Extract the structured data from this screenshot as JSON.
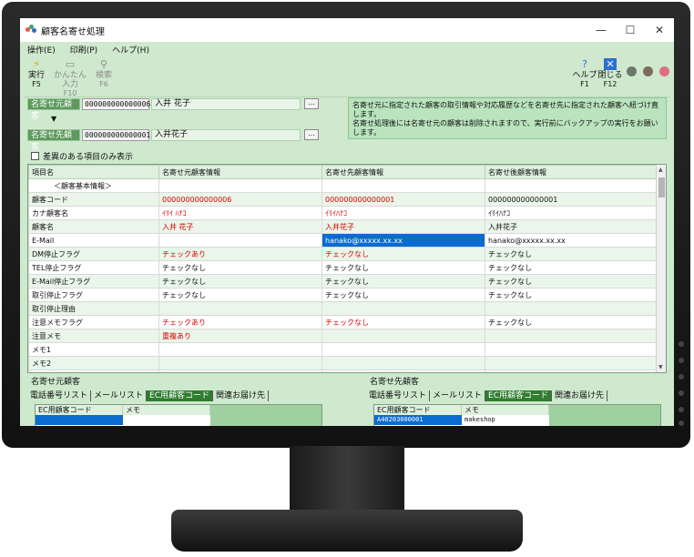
{
  "window": {
    "title": "顧客名寄せ処理",
    "controls": [
      "—",
      "☐",
      "✕"
    ]
  },
  "menu": [
    "操作(E)",
    "印刷(P)",
    "ヘルプ(H)"
  ],
  "toolbar": {
    "left": [
      {
        "label": "実行",
        "key": "F5",
        "icon": "bolt-icon",
        "enabled": true
      },
      {
        "label": "かんたん入力",
        "key": "F10",
        "icon": "window-icon",
        "enabled": false
      },
      {
        "label": "検索",
        "key": "F6",
        "icon": "search-icon",
        "enabled": false
      }
    ],
    "right": [
      {
        "label": "ヘルプ",
        "key": "F1",
        "icon": "help-icon"
      },
      {
        "label": "閉じる",
        "key": "F12",
        "icon": "close-icon"
      }
    ],
    "status_colors": [
      "#6b7a6b",
      "#7a6b5a",
      "#e07080"
    ]
  },
  "source_customer": {
    "label": "名寄せ元顧客",
    "code": "000000000000006",
    "name": "入井 花子",
    "button": "…"
  },
  "arrow": "▼",
  "target_customer": {
    "label": "名寄せ先顧客",
    "code": "000000000000001",
    "name": "入井花子",
    "button": "…"
  },
  "info_text": [
    "名寄せ元に指定された顧客の取引情報や対応履歴などを名寄せ先に指定された顧客へ紐づけ直します。",
    "名寄せ処理後には名寄せ元の顧客は削除されますので、実行前にバックアップの実行をお願いします。"
  ],
  "diff_only_label": "差異のある項目のみ表示",
  "grid": {
    "headers": [
      "項目名",
      "名寄せ元顧客情報",
      "名寄せ先顧客情報",
      "名寄せ後顧客情報"
    ],
    "rows": [
      {
        "cells": [
          "　　　＜顧客基本情報＞",
          "",
          "",
          ""
        ],
        "red": []
      },
      {
        "cells": [
          "顧客コード",
          "000000000000006",
          "000000000000001",
          "000000000000001"
        ],
        "red": [
          1,
          2
        ]
      },
      {
        "cells": [
          "カナ顧客名",
          "ｲﾘｲ ﾊﾅｺ",
          "ｲﾘｲﾊﾅｺ",
          "ｲﾘｲﾊﾅｺ"
        ],
        "red": [
          1,
          2
        ]
      },
      {
        "cells": [
          "顧客名",
          "入井 花子",
          "入井花子",
          "入井花子"
        ],
        "red": [
          1,
          2
        ]
      },
      {
        "cells": [
          "E-Mail",
          "",
          "hanako@xxxxx.xx.xx",
          "hanako@xxxxx.xx.xx"
        ],
        "red": [],
        "selected": 2
      },
      {
        "cells": [
          "DM停止フラグ",
          "チェックあり",
          "チェックなし",
          "チェックなし"
        ],
        "red": [
          1,
          2
        ]
      },
      {
        "cells": [
          "TEL停止フラグ",
          "チェックなし",
          "チェックなし",
          "チェックなし"
        ],
        "red": []
      },
      {
        "cells": [
          "E-Mail停止フラグ",
          "チェックなし",
          "チェックなし",
          "チェックなし"
        ],
        "red": []
      },
      {
        "cells": [
          "取引停止フラグ",
          "チェックなし",
          "チェックなし",
          "チェックなし"
        ],
        "red": []
      },
      {
        "cells": [
          "取引停止理由",
          "",
          "",
          ""
        ],
        "red": []
      },
      {
        "cells": [
          "注意メモフラグ",
          "チェックあり",
          "チェックなし",
          "チェックなし"
        ],
        "red": [
          1,
          2
        ]
      },
      {
        "cells": [
          "注意メモ",
          "重複あり",
          "",
          ""
        ],
        "red": [
          1
        ]
      },
      {
        "cells": [
          "メモ1",
          "",
          "",
          ""
        ],
        "red": []
      },
      {
        "cells": [
          "メモ2",
          "",
          "",
          ""
        ],
        "red": []
      },
      {
        "cells": [
          "",
          "",
          "",
          ""
        ],
        "red": []
      }
    ]
  },
  "panels": [
    {
      "title": "名寄せ元顧客",
      "tabs": [
        "電話番号リスト",
        "メールリスト",
        "EC用顧客コード",
        "関連お届け先"
      ],
      "active_tab": 2,
      "columns": [
        "EC用顧客コード",
        "メモ"
      ],
      "rows": [
        [
          "",
          ""
        ]
      ]
    },
    {
      "title": "名寄せ先顧客",
      "tabs": [
        "電話番号リスト",
        "メールリスト",
        "EC用顧客コード",
        "関連お届け先"
      ],
      "active_tab": 2,
      "columns": [
        "EC用顧客コード",
        "メモ"
      ],
      "rows": [
        [
          "A40203000001",
          "makeshop"
        ]
      ]
    }
  ]
}
